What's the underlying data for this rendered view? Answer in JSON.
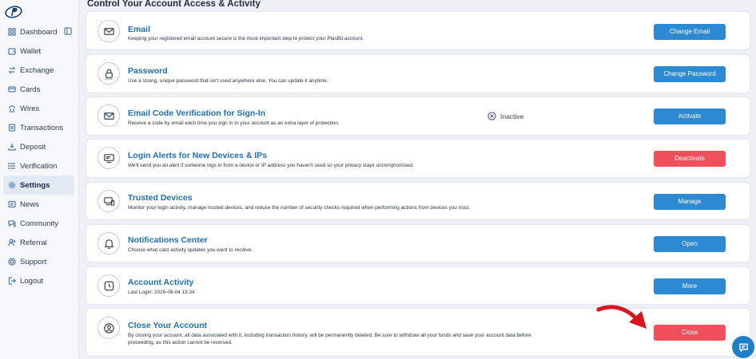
{
  "sidebar": {
    "items": [
      {
        "label": "Dashboard",
        "icon": "dashboard-icon"
      },
      {
        "label": "Wallet",
        "icon": "wallet-icon"
      },
      {
        "label": "Exchange",
        "icon": "exchange-icon"
      },
      {
        "label": "Cards",
        "icon": "card-icon"
      },
      {
        "label": "Wires",
        "icon": "wires-icon"
      },
      {
        "label": "Transactions",
        "icon": "transactions-icon"
      },
      {
        "label": "Deposit",
        "icon": "deposit-icon"
      },
      {
        "label": "Verification",
        "icon": "verification-icon"
      },
      {
        "label": "Settings",
        "icon": "settings-icon",
        "active": true
      },
      {
        "label": "News",
        "icon": "news-icon"
      },
      {
        "label": "Community",
        "icon": "community-icon"
      },
      {
        "label": "Referral",
        "icon": "referral-icon"
      },
      {
        "label": "Support",
        "icon": "support-icon"
      },
      {
        "label": "Logout",
        "icon": "logout-icon"
      }
    ]
  },
  "page": {
    "title": "Control Your Account Access & Activity"
  },
  "cards": [
    {
      "title": "Email",
      "desc": "Keeping your registered email account secure is the most important step to protect your PlasBit account.",
      "button": "Change Email",
      "icon": "email-icon",
      "color": "blue"
    },
    {
      "title": "Password",
      "desc": "Use a strong, unique password that isn't used anywhere else. You can update it anytime.",
      "button": "Change Password",
      "icon": "password-lock-icon",
      "color": "blue"
    },
    {
      "title": "Email Code Verification for Sign-In",
      "desc": "Receive a code by email each time you sign in to your account as an extra layer of protection.",
      "button": "Activate",
      "icon": "email-code-icon",
      "color": "blue",
      "status": "Inactive"
    },
    {
      "title": "Login Alerts for New Devices & IPs",
      "desc": "We'll send you an alert if someone logs in from a device or IP address you haven't used so your privacy stays uncompromised.",
      "button": "Deactivate",
      "icon": "login-alert-icon",
      "color": "red"
    },
    {
      "title": "Trusted Devices",
      "desc": "Monitor your login activity, manage trusted devices, and reduce the number of security checks required when performing actions from devices you trust.",
      "button": "Manage",
      "icon": "devices-icon",
      "color": "blue"
    },
    {
      "title": "Notifications Center",
      "desc": "Choose what card activity updates you want to receive.",
      "button": "Open",
      "icon": "bell-icon",
      "color": "blue"
    },
    {
      "title": "Account Activity",
      "desc": "Last Login: 2026-08-04 13:34",
      "button": "More",
      "icon": "activity-icon",
      "color": "blue"
    },
    {
      "title": "Close Your Account",
      "desc": "By closing your account, all data associated with it, including transaction history, will be permanently deleted. Be sure to withdraw all your funds and save your account data before proceeding, as this action cannot be reversed.",
      "button": "Close",
      "icon": "close-account-icon",
      "color": "red"
    }
  ],
  "colors": {
    "accent_blue": "#2c89d2",
    "danger_red": "#f0505c",
    "title_blue": "#1e6fb8",
    "arrow_red": "#d8141c"
  }
}
